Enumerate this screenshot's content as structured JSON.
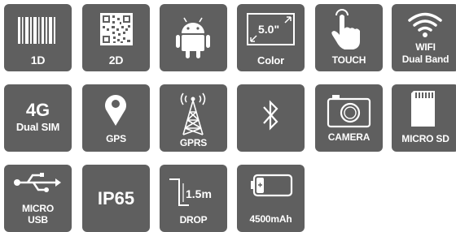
{
  "features": {
    "barcode_1d": {
      "label": "1D",
      "icon": "barcode-icon"
    },
    "qr_2d": {
      "label": "2D",
      "icon": "qr-code-icon"
    },
    "android": {
      "label": "",
      "icon": "android-icon"
    },
    "display": {
      "size": "5.0\"",
      "label": "Color",
      "icon": "screen-size-icon"
    },
    "touch": {
      "label": "TOUCH",
      "icon": "touch-hand-icon"
    },
    "wifi": {
      "label_top": "WIFI",
      "label_bottom": "Dual Band",
      "icon": "wifi-icon"
    },
    "network": {
      "big": "4G",
      "label": "Dual SIM",
      "icon": "none"
    },
    "gps": {
      "label": "GPS",
      "icon": "map-pin-icon"
    },
    "gprs": {
      "label": "GPRS",
      "icon": "antenna-tower-icon"
    },
    "bluetooth": {
      "label": "",
      "icon": "bluetooth-icon"
    },
    "camera": {
      "label": "CAMERA",
      "icon": "camera-icon"
    },
    "microsd": {
      "label": "MICRO SD",
      "icon": "sd-card-icon"
    },
    "usb": {
      "label_top": "MICRO",
      "label_bottom": "USB",
      "icon": "usb-icon"
    },
    "ip": {
      "big": "IP65",
      "icon": "none"
    },
    "drop": {
      "height": "1.5m",
      "label": "DROP",
      "icon": "drop-step-icon"
    },
    "battery": {
      "label": "4500mAh",
      "icon": "battery-icon"
    }
  },
  "colors": {
    "tile": "#5f5f5f",
    "icon": "#ffffff"
  }
}
